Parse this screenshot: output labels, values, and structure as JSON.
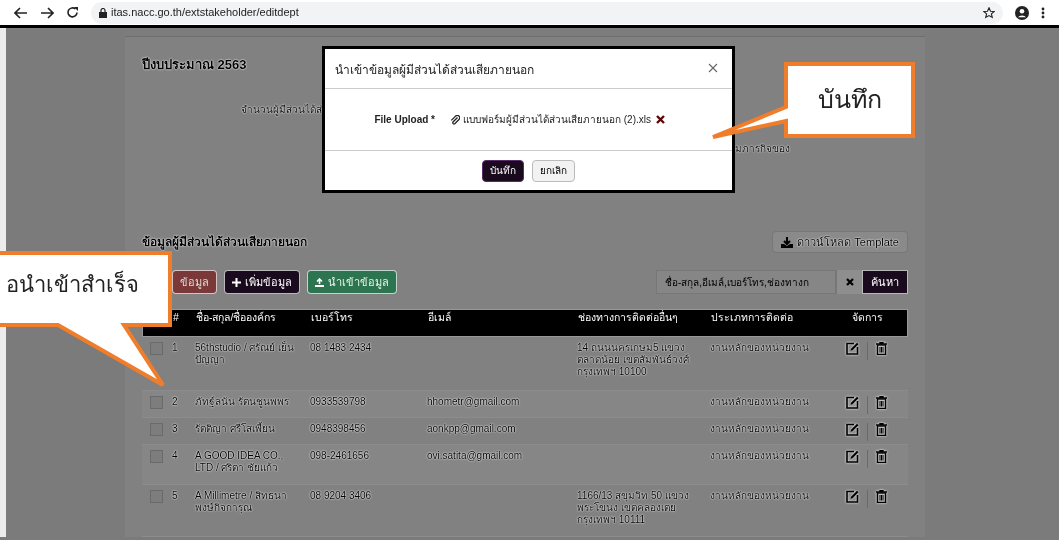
{
  "browser": {
    "url": "itas.nacc.go.th/extstakeholder/editdept"
  },
  "page": {
    "heading": "ปีงบประมาณ 2563",
    "count_label": "จำนวนผู้มีส่วนได้ส่",
    "mission_label": "มภารกิจของ"
  },
  "modal": {
    "title": "นำเข้าข้อมูลผู้มีส่วนได้ส่วนเสียภายนอก",
    "field_label": "File Upload *",
    "file_name": "แบบฟอร์มผู้มีส่วนได้ส่วนเสียภายนอก (2).xls",
    "buttons": [
      {
        "label": "บันทึก",
        "kind": "primary"
      },
      {
        "label": "ยกเลิก",
        "kind": "default"
      }
    ]
  },
  "section": {
    "title": "ข้อมูลผู้มีส่วนได้ส่วนเสียภายนอก",
    "download": "ดาวน์โหลด Template",
    "buttons": [
      {
        "label": "ข้อมูล",
        "kind": "delete"
      },
      {
        "label": "เพิ่มข้อมูล",
        "kind": "add"
      },
      {
        "label": "นำเข้าข้อมูล",
        "kind": "import"
      }
    ],
    "search": {
      "placeholder": "ชื่อ-สกุล,อีเมล์,เบอร์โทร,ช่องทางก",
      "button": "ค้นหา"
    }
  },
  "table": {
    "columns": [
      "#",
      "ชื่อ-สกุล/ชื่อองค์กร",
      "เบอร์โทร",
      "อีเมล์",
      "ช่องทางการติดต่ออื่นๆ",
      "ประเภทการติดต่อ",
      "จัดการ"
    ],
    "rows": [
      {
        "checked": false,
        "index": "1",
        "name": "56thstudio / ศรัณย์ เย็นปัญญา",
        "phone": "08 1483 2434",
        "contact": "14 ถนนนครเกษม5 แขวงตลาดน้อย เขตสัมพันธ์วงศ์ กรุงเทพฯ 10100",
        "type": "งานหลักของหน่วยงาน"
      },
      {
        "checked": false,
        "index": "2",
        "name": "ภัทฐ์ลนัน รัตนชูนพพร",
        "phone": "0933539798",
        "email": "hhometr@gmail.com",
        "type": "งานหลักของหน่วยงาน"
      },
      {
        "checked": false,
        "index": "3",
        "name": "รัตติญา ศรีโสเพี้ยน",
        "phone": "0948398456",
        "email": "aonkpp@gmail.com",
        "type": "งานหลักของหน่วยงาน"
      },
      {
        "checked": false,
        "index": "4",
        "name": "A GOOD IDEA CO., LTD / ศริตา ชัยแก้ว",
        "phone": "098-2461656",
        "email": "ovi.satita@gmail.com",
        "type": "งานหลักของหน่วยงาน"
      },
      {
        "checked": false,
        "index": "5",
        "name": "A Millimetre / สิทธนา พงษ์กิจการุณ",
        "phone": "08 9204 3406",
        "contact": "1166/13 สุขุมวิท 50 แขวงพระโขนง เขตคลองเตย กรุงเทพฯ 10111",
        "type": "งานหลักของหน่วยงาน"
      }
    ]
  },
  "callouts": [
    {
      "text": "บันทึก"
    },
    {
      "text": "อนำเข้าสำเร็จ"
    }
  ]
}
